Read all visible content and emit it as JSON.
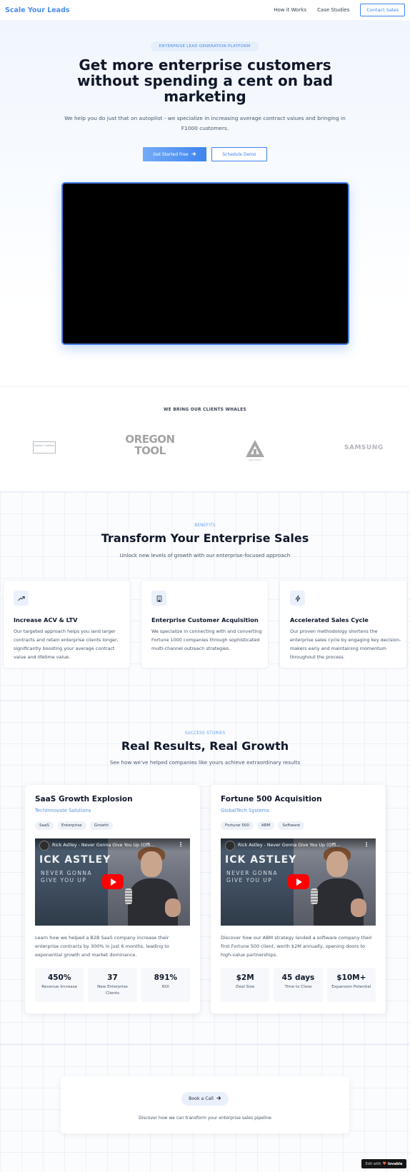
{
  "nav": {
    "logo": "Scale Your Leads",
    "links": [
      "How it Works",
      "Case Studies"
    ],
    "cta": "Contact Sales"
  },
  "hero": {
    "badge": "ENTERPRISE LEAD GENERATION PLATFORM",
    "title": "Get more enterprise customers without spending a cent on bad marketing",
    "subtitle": "We help you do just that on autopilot - we specialize in increasing average contract values and bringing in F1000 customers.",
    "primary_button": "Get Started Free",
    "secondary_button": "Schedule Demo"
  },
  "clients": {
    "title": "WE BRING OUR CLIENTS WHALES",
    "logos": [
      "Shower Caddies",
      "OREGON TOOL",
      "AJAX TOCCO",
      "SAMSUNG"
    ]
  },
  "benefits": {
    "eyebrow": "BENEFITS",
    "title": "Transform Your Enterprise Sales",
    "subtitle": "Unlock new levels of growth with our enterprise-focused approach",
    "cards": [
      {
        "icon": "trending-up-icon",
        "title": "Increase ACV & LTV",
        "description": "Our targeted approach helps you land larger contracts and retain enterprise clients longer, significantly boosting your average contract value and lifetime value."
      },
      {
        "icon": "building-icon",
        "title": "Enterprise Customer Acquisition",
        "description": "We specialize in connecting with and converting Fortune 1000 companies through sophisticated multi-channel outreach strategies."
      },
      {
        "icon": "lightning-icon",
        "title": "Accelerated Sales Cycle",
        "description": "Our proven methodology shortens the enterprise sales cycle by engaging key decision-makers early and maintaining momentum throughout the process."
      }
    ]
  },
  "success": {
    "eyebrow": "SUCCESS STORIES",
    "title": "Real Results, Real Growth",
    "subtitle": "See how we've helped companies like yours achieve extraordinary results",
    "video": {
      "title": "Rick Astley - Never Gonna Give You Up (Offi...",
      "overlay_line1": "ICK ASTLEY",
      "overlay_line2": "NEVER GONNA GIVE YOU UP"
    },
    "cases": [
      {
        "title": "SaaS Growth Explosion",
        "company": "TechInnovate Solutions",
        "tags": [
          "SaaS",
          "Enterprise",
          "Growth"
        ],
        "description": "Learn how we helped a B2B SaaS company increase their enterprise contracts by 300% in just 6 months, leading to exponential growth and market dominance.",
        "stats": [
          {
            "value": "450%",
            "label": "Revenue Increase"
          },
          {
            "value": "37",
            "label": "New Enterprise Clients"
          },
          {
            "value": "891%",
            "label": "ROI"
          }
        ]
      },
      {
        "title": "Fortune 500 Acquisition",
        "company": "GlobalTech Systems",
        "tags": [
          "Fortune 500",
          "ABM",
          "Software"
        ],
        "description": "Discover how our ABM strategy landed a software company their first Fortune 500 client, worth $2M annually, opening doors to high-value partnerships.",
        "stats": [
          {
            "value": "$2M",
            "label": "Deal Size"
          },
          {
            "value": "45 days",
            "label": "Time to Close"
          },
          {
            "value": "$10M+",
            "label": "Expansion Potential"
          }
        ]
      }
    ]
  },
  "cta": {
    "button": "Book a Call",
    "subtitle": "Discover how we can transform your enterprise sales pipeline"
  },
  "badge": {
    "prefix": "Edit with",
    "brand": "lovable"
  },
  "colors": {
    "accent": "#3b82f6",
    "heading": "#0f172a",
    "body": "#475569"
  }
}
